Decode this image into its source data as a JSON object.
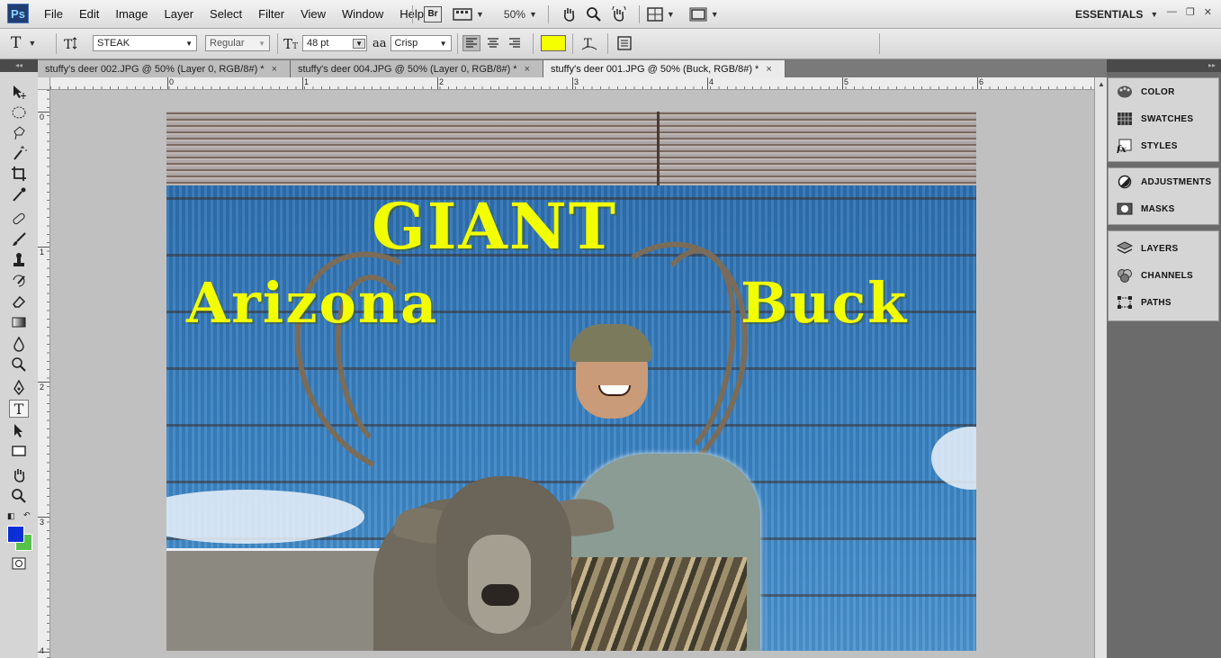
{
  "app": {
    "logo": "Ps",
    "workspace": "ESSENTIALS"
  },
  "menu": [
    "File",
    "Edit",
    "Image",
    "Layer",
    "Select",
    "Filter",
    "View",
    "Window",
    "Help"
  ],
  "menubar_tools": {
    "bridge_label": "Br",
    "zoom": "50%"
  },
  "options": {
    "tool_glyph": "T",
    "font_family": "STEAK",
    "font_style": "Regular",
    "font_size": "48 pt",
    "aa_label": "aa",
    "antialias": "Crisp",
    "text_color": "#f5ff00"
  },
  "tabs": [
    {
      "label": "stuffy's deer 002.JPG @ 50% (Layer 0, RGB/8#) *",
      "close": "×"
    },
    {
      "label": "stuffy's deer 004.JPG @ 50% (Layer 0, RGB/8#) *",
      "close": "×"
    },
    {
      "label": "stuffy's deer 001.JPG @ 50% (Buck, RGB/8#) *",
      "close": "×"
    }
  ],
  "ruler_h": [
    "0",
    "1",
    "2",
    "3",
    "4",
    "5",
    "6"
  ],
  "ruler_v": [
    "0",
    "1",
    "2",
    "3",
    "4"
  ],
  "canvas_text": {
    "line1": "GIANT",
    "line2a": "Arizona",
    "line2b": "Buck"
  },
  "colors": {
    "foreground": "#0b2fd6",
    "background": "#57c24a"
  },
  "panels": {
    "group1": [
      "COLOR",
      "SWATCHES",
      "STYLES"
    ],
    "group2": [
      "ADJUSTMENTS",
      "MASKS"
    ],
    "group3": [
      "LAYERS",
      "CHANNELS",
      "PATHS"
    ]
  }
}
